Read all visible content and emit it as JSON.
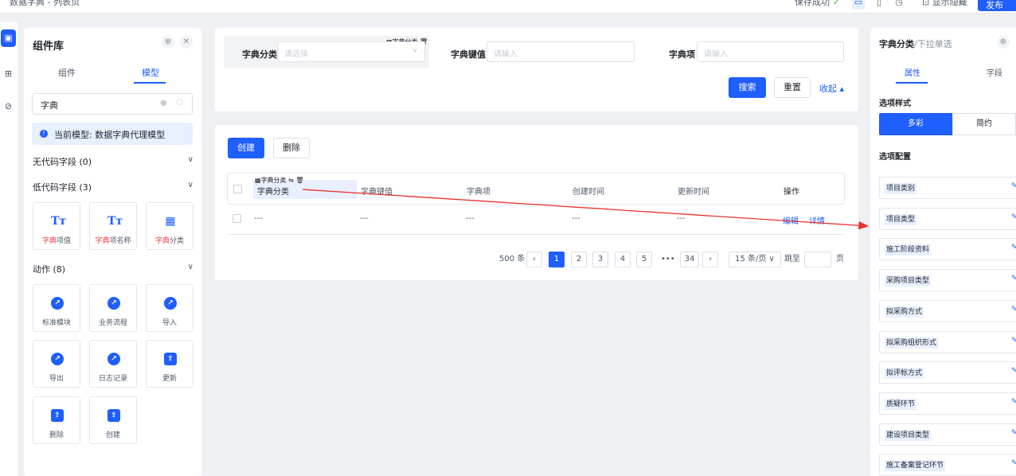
{
  "topbar": {
    "breadcrumb": "数据字典 - 列表页",
    "save_status": "保存成功",
    "save_ok_icon": "check-circle-icon",
    "device_icons": [
      "desktop-icon",
      "mobile-icon",
      "history-icon"
    ],
    "preview_label": "显示隐藏",
    "publish_label": "发布"
  },
  "rail": {
    "items": [
      "component-icon",
      "tree-icon",
      "compass-icon"
    ]
  },
  "left_panel": {
    "title": "组件库",
    "tabs": [
      {
        "label": "组件",
        "active": false
      },
      {
        "label": "模型",
        "active": true
      }
    ],
    "search_value": "字典",
    "info_text": "当前模型: 数据字典代理模型",
    "sections": [
      {
        "label": "无代码字段 (0)"
      },
      {
        "label": "低代码字段 (3)"
      },
      {
        "label": "动作 (8)"
      }
    ],
    "field_cards": [
      {
        "icon": "text-icon",
        "glyph": "Tт",
        "highlight": "字典",
        "rest": "项值"
      },
      {
        "icon": "text-icon",
        "glyph": "Tт",
        "highlight": "字典",
        "rest": "项名称"
      },
      {
        "icon": "chart-icon",
        "glyph": "▦",
        "highlight": "字典",
        "rest": "分类"
      }
    ],
    "action_cards": [
      {
        "icon": "share-icon",
        "glyph": "↗",
        "label": "标准模块"
      },
      {
        "icon": "share-icon",
        "glyph": "↗",
        "label": "业务流程"
      },
      {
        "icon": "share-icon",
        "glyph": "↗",
        "label": "导入"
      },
      {
        "icon": "share-icon",
        "glyph": "↗",
        "label": "导出"
      },
      {
        "icon": "share-icon",
        "glyph": "↗",
        "label": "日志记录"
      },
      {
        "icon": "upload-icon",
        "glyph": "⇪",
        "label": "更新"
      },
      {
        "icon": "upload-icon",
        "glyph": "⇪",
        "label": "删除"
      },
      {
        "icon": "upload-icon",
        "glyph": "⇪",
        "label": "创建"
      }
    ]
  },
  "filter": {
    "fields": [
      {
        "label": "字典分类",
        "placeholder": "请选择"
      },
      {
        "label": "字典键值",
        "placeholder": "请输入"
      },
      {
        "label": "字典项",
        "placeholder": "请输入"
      }
    ],
    "floating_tag": "字典分类",
    "search_label": "搜索",
    "reset_label": "重置",
    "collapse_label": "收起 ▴"
  },
  "table": {
    "create_label": "创建",
    "delete_label": "删除",
    "columns": [
      "字典分类",
      "字典键值",
      "字典项",
      "创建时间",
      "更新时间",
      "操作"
    ],
    "header_tag": "字典分类",
    "row": [
      "---",
      "---",
      "---",
      "---",
      "---"
    ],
    "actions": [
      "编辑",
      "详情"
    ]
  },
  "pagination": {
    "total": "500 条",
    "pages": [
      "1",
      "2",
      "3",
      "4",
      "5"
    ],
    "ellipsis": "•••",
    "last_page": "34",
    "current_page": 1,
    "page_size": "15 条/页 ∨",
    "jump_label": "跳至",
    "page_suffix": "页"
  },
  "right_panel": {
    "title": "字典分类",
    "subtitle": "/下拉单选",
    "tabs": [
      {
        "label": "属性",
        "active": true
      },
      {
        "label": "字段",
        "active": false
      }
    ],
    "style_label": "选项样式",
    "style_options": [
      "多彩",
      "简约"
    ],
    "config_label": "选项配置",
    "options": [
      "项目类别",
      "项目类型",
      "施工阶段资料",
      "采购项目类型",
      "拟采购方式",
      "拟采购组织形式",
      "拟评标方式",
      "质疑环节",
      "建设项目类型",
      "施工备案登记环节"
    ]
  },
  "colors": {
    "accent": "#1f5eff",
    "highlight": "#f53f3f",
    "annotation_arrow": "#e8322d"
  }
}
